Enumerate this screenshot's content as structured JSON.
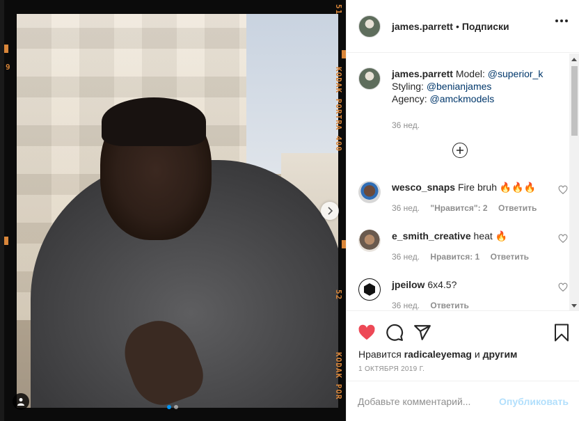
{
  "post": {
    "username": "james.parrett",
    "separator": "•",
    "follow_label": "Подписки",
    "more_icon": "more-horizontal-icon"
  },
  "film": {
    "right_top": "51",
    "right_brand_1": "KODAK PORTRA 400",
    "right_mid": "52",
    "right_brand_2": "KODAK POR",
    "left_num": "9"
  },
  "caption": {
    "username": "james.parrett",
    "line1_prefix": "Model: ",
    "line1_mention": "@superior_k",
    "line2_prefix": "Styling: ",
    "line2_mention": "@benianjames",
    "line3_prefix": "Agency: ",
    "line3_mention": "@amckmodels",
    "age": "36 нед."
  },
  "comments": [
    {
      "username": "wesco_snaps",
      "text": "Fire bruh 🔥🔥🔥",
      "age": "36 нед.",
      "likes": "\"Нравится\": 2",
      "reply": "Ответить"
    },
    {
      "username": "e_smith_creative",
      "text": "heat 🔥",
      "age": "36 нед.",
      "likes": "Нравится: 1",
      "reply": "Ответить"
    },
    {
      "username": "jpeilow",
      "text": "6x4.5?",
      "age": "36 нед.",
      "likes": "",
      "reply": "Ответить"
    }
  ],
  "actions": {
    "liked_by_prefix": "Нравится ",
    "liked_by_user": "radicaleyemag",
    "liked_by_suffix": " и ",
    "liked_by_others": "другим",
    "date": "1 ОКТЯБРЯ 2019 Г."
  },
  "comment_box": {
    "placeholder": "Добавьте комментарий...",
    "publish_label": "Опубликовать"
  },
  "colors": {
    "like_red": "#ed4956",
    "mention_blue": "#00376b",
    "publish_disabled": "#b2dffc",
    "film_orange": "#d9863a"
  },
  "carousel": {
    "slide": 1,
    "total": 2
  }
}
